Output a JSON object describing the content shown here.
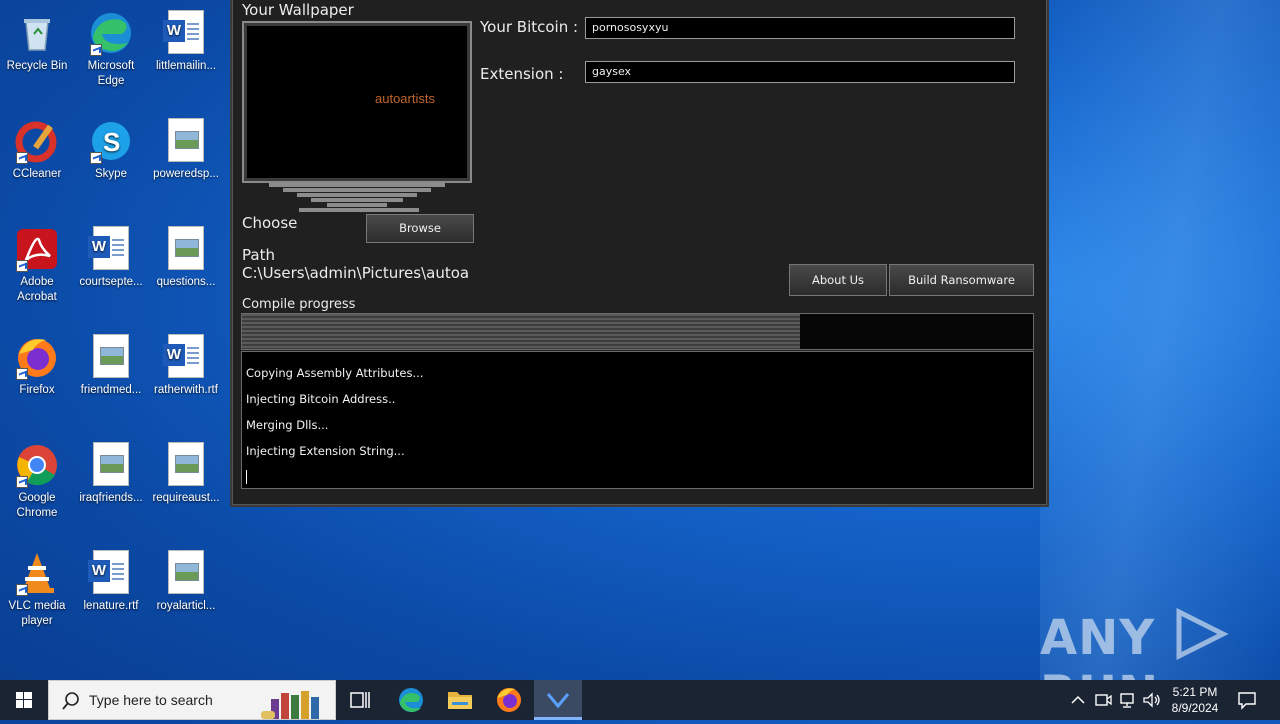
{
  "desktop": {
    "icons": [
      {
        "label": "Recycle Bin",
        "kind": "recycle-bin"
      },
      {
        "label": "Microsoft Edge",
        "kind": "edge"
      },
      {
        "label": "littlemailin...",
        "kind": "word"
      },
      {
        "label": "CCleaner",
        "kind": "ccleaner"
      },
      {
        "label": "Skype",
        "kind": "skype"
      },
      {
        "label": "poweredsp...",
        "kind": "image"
      },
      {
        "label": "Adobe Acrobat",
        "kind": "acrobat"
      },
      {
        "label": "courtsepte...",
        "kind": "word"
      },
      {
        "label": "questions...",
        "kind": "image"
      },
      {
        "label": "Firefox",
        "kind": "firefox"
      },
      {
        "label": "friendmed...",
        "kind": "image"
      },
      {
        "label": "ratherwith.rtf",
        "kind": "word"
      },
      {
        "label": "Google Chrome",
        "kind": "chrome"
      },
      {
        "label": "iraqfriends...",
        "kind": "image"
      },
      {
        "label": "requireaust...",
        "kind": "image"
      },
      {
        "label": "VLC media player",
        "kind": "vlc"
      },
      {
        "label": "lenature.rtf",
        "kind": "word"
      },
      {
        "label": "royalarticl...",
        "kind": "image"
      }
    ]
  },
  "app": {
    "wallpaper_label": "Your Wallpaper",
    "wallpaper_preview_text": "autoartists",
    "bitcoin_label": "Your Bitcoin :",
    "bitcoin_value": "pornososyxyu",
    "extension_label": "Extension :",
    "extension_value": "gaysex",
    "choose_label": "Choose",
    "browse_button": "Browse",
    "path_label": "Path",
    "path_value": "C:\\Users\\admin\\Pictures\\autoa",
    "about_button": "About Us",
    "build_button": "Build Ransomware",
    "progress_label": "Compile progress",
    "progress_fraction": 0.705,
    "log_lines": [
      "Copying Assembly Attributes...",
      "Injecting Bitcoin Address..",
      "Merging Dlls...",
      "Injecting Extension String..."
    ]
  },
  "watermark": {
    "text_left": "ANY",
    "text_right": "RUN"
  },
  "taskbar": {
    "search_placeholder": "Type here to search",
    "time": "5:21 PM",
    "date": "8/9/2024",
    "icons": [
      "windows-start-icon",
      "task-view-icon",
      "edge-icon",
      "file-explorer-icon",
      "firefox-icon",
      "ransomware-builder-icon"
    ]
  },
  "colors": {
    "desktop_blue": "#1565cc",
    "app_background": "#202020",
    "wallpaper_text": "#c0652a",
    "taskbar": "#1b2433"
  }
}
